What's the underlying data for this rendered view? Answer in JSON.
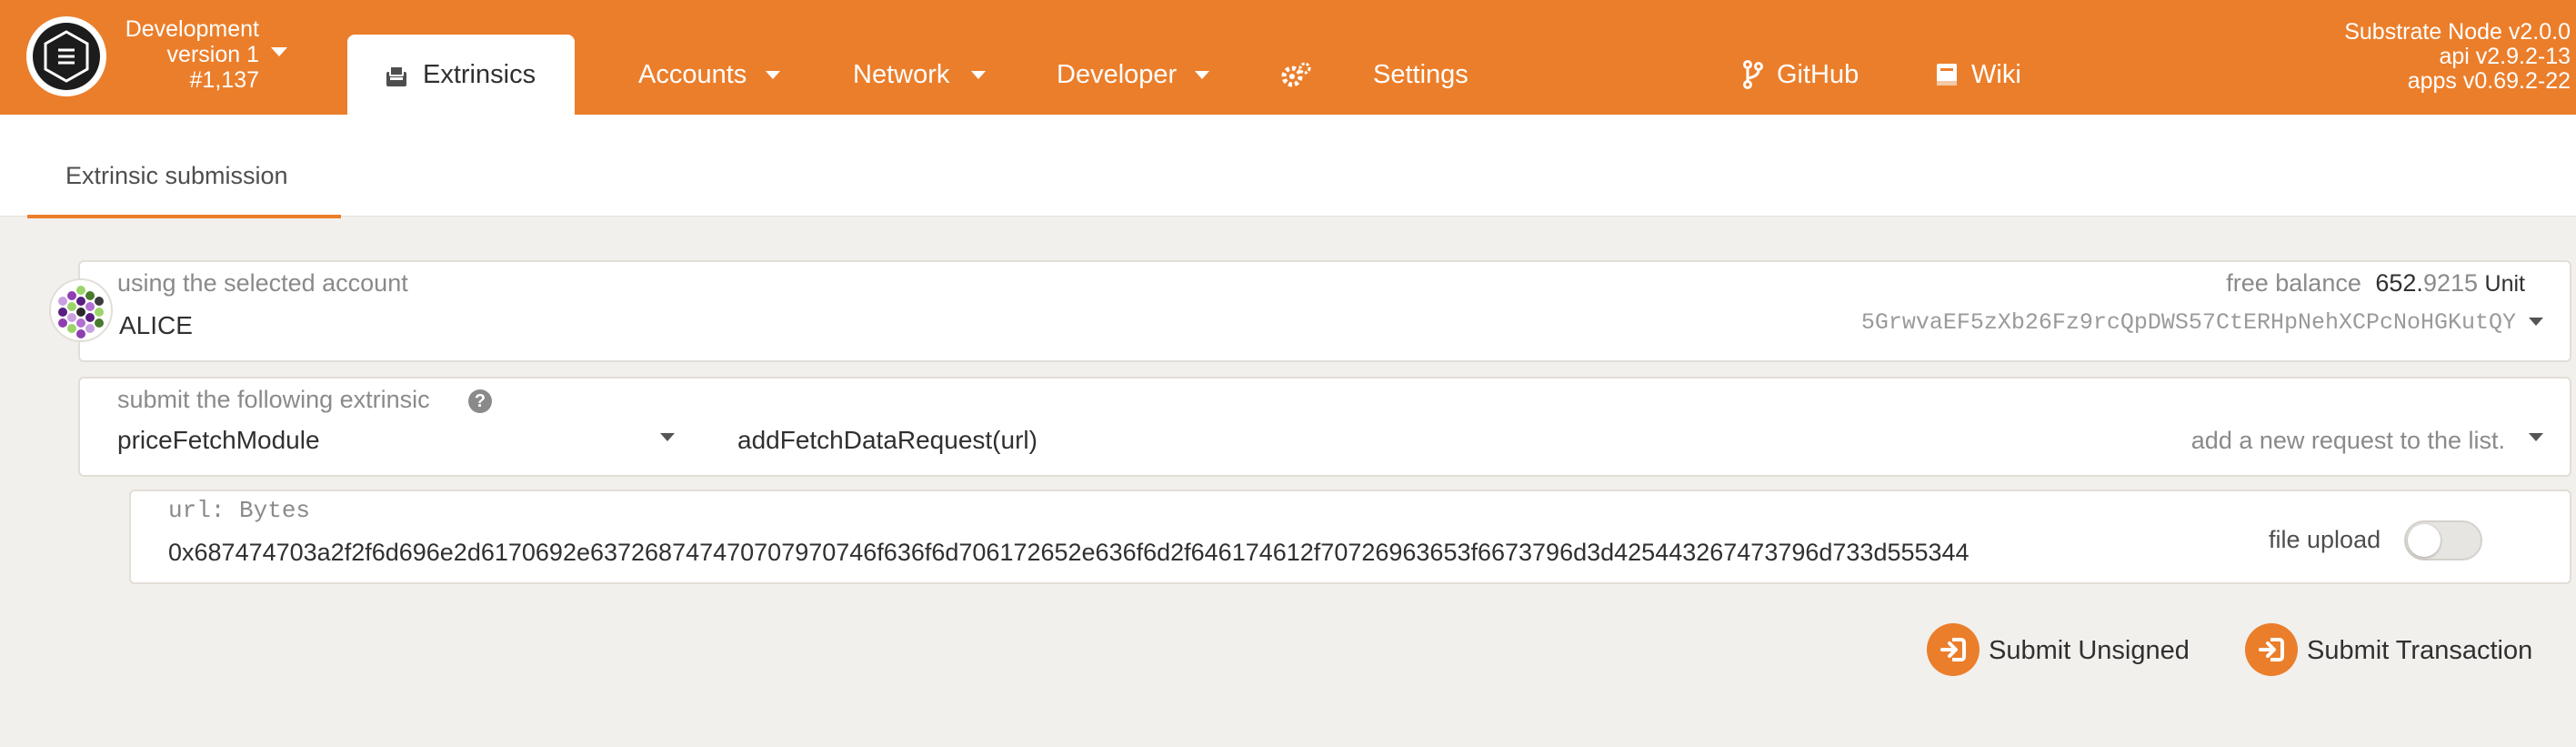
{
  "chain": {
    "name": "Development",
    "version": "version 1",
    "block": "#1,137"
  },
  "nav": {
    "extrinsics": "Extrinsics",
    "accounts": "Accounts",
    "network": "Network",
    "developer": "Developer",
    "settings": "Settings",
    "github": "GitHub",
    "wiki": "Wiki"
  },
  "node_info": {
    "node": "Substrate Node v2.0.0",
    "api": "api v2.9.2-13",
    "apps": "apps v0.69.2-22"
  },
  "subtab": "Extrinsic submission",
  "account": {
    "label": "using the selected account",
    "name": "ALICE",
    "balance_label": "free balance",
    "balance_int": "652.",
    "balance_dec": "9215",
    "balance_unit": "Unit",
    "address": "5GrwvaEF5zXb26Fz9rcQpDWS57CtERHpNehXCPcNoHGKutQY"
  },
  "extrinsic": {
    "label": "submit the following extrinsic",
    "module": "priceFetchModule",
    "method": "addFetchDataRequest(url)",
    "description": "add a new request to the list."
  },
  "param": {
    "label": "url: Bytes",
    "value": "0x687474703a2f2f6d696e2d6170692e637268747470707970746f636f6d706172652e636f6d2f646174612f70726963653f6673796d3d425443267473796d733d555344",
    "file_upload_label": "file upload"
  },
  "buttons": {
    "submit_unsigned": "Submit Unsigned",
    "submit_transaction": "Submit Transaction"
  },
  "colors": {
    "accent": "#eb7e2b",
    "background": "#f2f0ed"
  }
}
